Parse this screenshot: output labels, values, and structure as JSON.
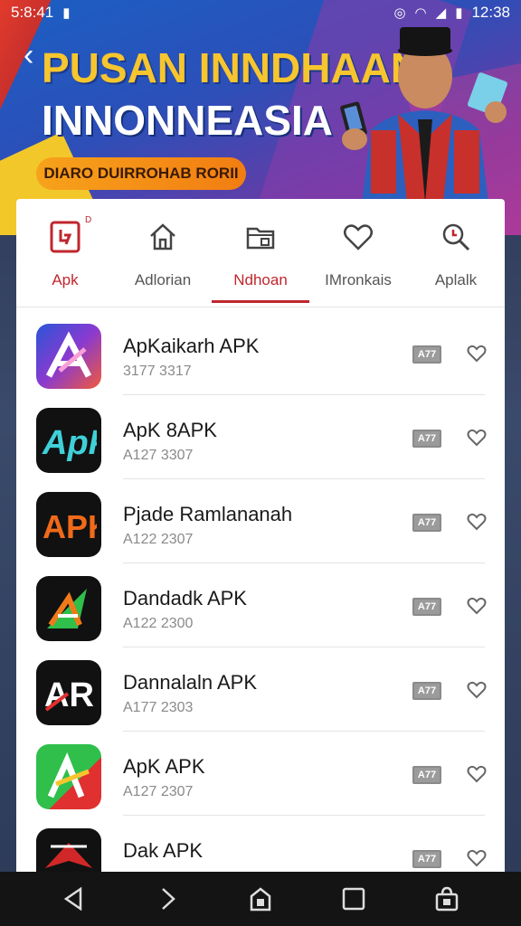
{
  "status": {
    "time": "5:8:41",
    "clock": "12:38"
  },
  "banner": {
    "title_line1": "PUSAN INNDHAAN",
    "title_line2": "INNONNEASIA",
    "pill_text": "DIARO DUIRROHAB RORII"
  },
  "tabs": [
    {
      "label": "Apk",
      "icon": "package-icon",
      "sup": "D",
      "active": false
    },
    {
      "label": "Adlorian",
      "icon": "home-icon",
      "active": false
    },
    {
      "label": "Ndhoan",
      "icon": "folder-icon",
      "active": true
    },
    {
      "label": "IMronkais",
      "icon": "heart-icon",
      "active": false
    },
    {
      "label": "Aplalk",
      "icon": "search-icon",
      "active": false
    }
  ],
  "apps": [
    {
      "name": "ApKaikarh APK",
      "sub": "3177 3317",
      "badge": "A77"
    },
    {
      "name": "ApK 8APK",
      "sub": "A127 3307",
      "badge": "A77"
    },
    {
      "name": "Pjade Ramlananah",
      "sub": "A122 2307",
      "badge": "A77"
    },
    {
      "name": "Dandadk APK",
      "sub": "A122 2300",
      "badge": "A77"
    },
    {
      "name": "Dannalaln APK",
      "sub": "A177 2303",
      "badge": "A77"
    },
    {
      "name": "ApK APK",
      "sub": "A127 2307",
      "badge": "A77"
    },
    {
      "name": "Dak APK",
      "sub": "",
      "badge": "A77"
    }
  ],
  "colors": {
    "accent": "#c0262d",
    "banner_yellow": "#f7c52e",
    "navbar": "#141414"
  }
}
